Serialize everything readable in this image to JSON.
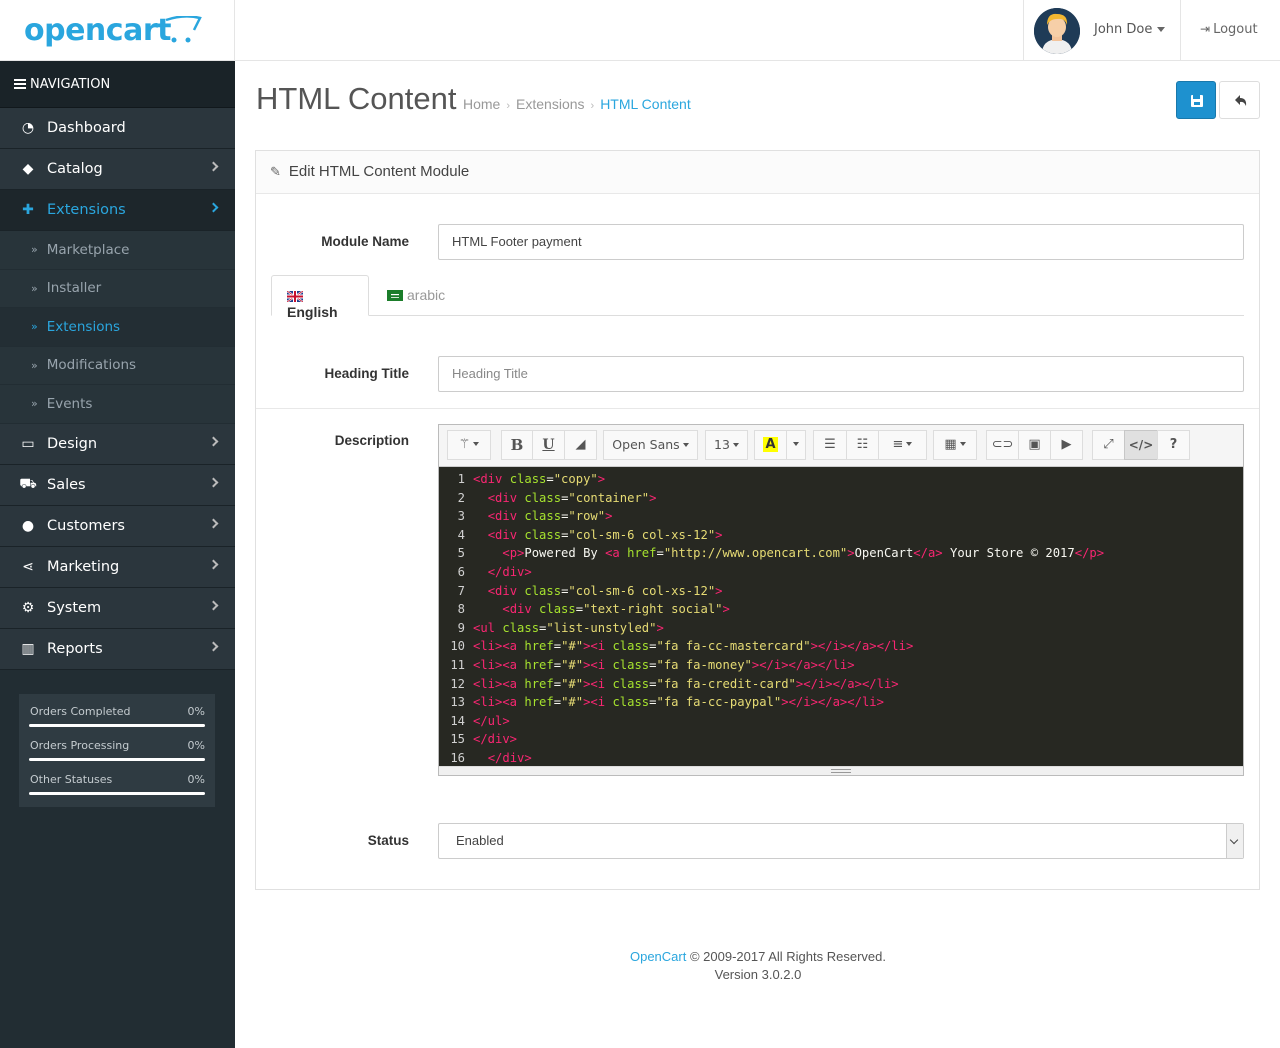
{
  "brand": {
    "name": "opencart"
  },
  "header": {
    "username": "John Doe",
    "logout_label": "Logout"
  },
  "nav": {
    "heading": "NAVIGATION",
    "items": [
      {
        "label": "Dashboard",
        "icon": "dashboard-icon"
      },
      {
        "label": "Catalog",
        "icon": "tag-icon"
      },
      {
        "label": "Extensions",
        "icon": "puzzle-icon"
      },
      {
        "label": "Design",
        "icon": "monitor-icon"
      },
      {
        "label": "Sales",
        "icon": "cart-icon"
      },
      {
        "label": "Customers",
        "icon": "user-icon"
      },
      {
        "label": "Marketing",
        "icon": "share-icon"
      },
      {
        "label": "System",
        "icon": "gear-icon"
      },
      {
        "label": "Reports",
        "icon": "bar-chart-icon"
      }
    ],
    "extensions_sub": [
      "Marketplace",
      "Installer",
      "Extensions",
      "Modifications",
      "Events"
    ]
  },
  "stats": [
    {
      "label": "Orders Completed",
      "value": "0%"
    },
    {
      "label": "Orders Processing",
      "value": "0%"
    },
    {
      "label": "Other Statuses",
      "value": "0%"
    }
  ],
  "page": {
    "title": "HTML Content",
    "breadcrumb": [
      "Home",
      "Extensions",
      "HTML Content"
    ]
  },
  "panel": {
    "heading": "Edit HTML Content Module",
    "module_name_label": "Module Name",
    "module_name_value": "HTML Footer payment",
    "tabs": [
      "English",
      "arabic"
    ],
    "heading_title_label": "Heading Title",
    "heading_title_placeholder": "Heading Title",
    "description_label": "Description",
    "status_label": "Status",
    "status_value": "Enabled"
  },
  "editor": {
    "font_name": "Open Sans",
    "font_size": "13",
    "lines": [
      {
        "n": "1",
        "indent": "",
        "parts": [
          [
            "tg",
            "<div "
          ],
          [
            "at",
            "class"
          ],
          [
            "tx",
            "="
          ],
          [
            "st",
            "\"copy\""
          ],
          [
            "tg",
            ">"
          ]
        ]
      },
      {
        "n": "2",
        "indent": "  ",
        "parts": [
          [
            "tg",
            "<div "
          ],
          [
            "at",
            "class"
          ],
          [
            "tx",
            "="
          ],
          [
            "st",
            "\"container\""
          ],
          [
            "tg",
            ">"
          ]
        ]
      },
      {
        "n": "3",
        "indent": "  ",
        "parts": [
          [
            "tg",
            "<div "
          ],
          [
            "at",
            "class"
          ],
          [
            "tx",
            "="
          ],
          [
            "st",
            "\"row\""
          ],
          [
            "tg",
            ">"
          ]
        ]
      },
      {
        "n": "4",
        "indent": "  ",
        "parts": [
          [
            "tg",
            "<div "
          ],
          [
            "at",
            "class"
          ],
          [
            "tx",
            "="
          ],
          [
            "st",
            "\"col-sm-6 col-xs-12\""
          ],
          [
            "tg",
            ">"
          ]
        ]
      },
      {
        "n": "5",
        "indent": "    ",
        "parts": [
          [
            "tg",
            "<p>"
          ],
          [
            "tx",
            "Powered By "
          ],
          [
            "tg",
            "<a "
          ],
          [
            "at",
            "href"
          ],
          [
            "tx",
            "="
          ],
          [
            "st",
            "\"http://www.opencart.com\""
          ],
          [
            "tg",
            ">"
          ],
          [
            "tx",
            "OpenCart"
          ],
          [
            "tg",
            "</a>"
          ],
          [
            "tx",
            " Your Store © 2017"
          ],
          [
            "tg",
            "</p>"
          ]
        ]
      },
      {
        "n": "6",
        "indent": "  ",
        "parts": [
          [
            "tg",
            "</div>"
          ]
        ]
      },
      {
        "n": "7",
        "indent": "  ",
        "parts": [
          [
            "tg",
            "<div "
          ],
          [
            "at",
            "class"
          ],
          [
            "tx",
            "="
          ],
          [
            "st",
            "\"col-sm-6 col-xs-12\""
          ],
          [
            "tg",
            ">"
          ]
        ]
      },
      {
        "n": "8",
        "indent": "    ",
        "parts": [
          [
            "tg",
            "<div "
          ],
          [
            "at",
            "class"
          ],
          [
            "tx",
            "="
          ],
          [
            "st",
            "\"text-right social\""
          ],
          [
            "tg",
            ">"
          ]
        ]
      },
      {
        "n": "9",
        "indent": "",
        "parts": [
          [
            "tg",
            "<ul "
          ],
          [
            "at",
            "class"
          ],
          [
            "tx",
            "="
          ],
          [
            "st",
            "\"list-unstyled\""
          ],
          [
            "tg",
            ">"
          ]
        ]
      },
      {
        "n": "10",
        "indent": "",
        "parts": [
          [
            "tg",
            "<li><a "
          ],
          [
            "at",
            "href"
          ],
          [
            "tx",
            "="
          ],
          [
            "st",
            "\"#\""
          ],
          [
            "tg",
            "><i "
          ],
          [
            "at",
            "class"
          ],
          [
            "tx",
            "="
          ],
          [
            "st",
            "\"fa fa-cc-mastercard\""
          ],
          [
            "tg",
            "></i></a></li>"
          ]
        ]
      },
      {
        "n": "11",
        "indent": "",
        "parts": [
          [
            "tg",
            "<li><a "
          ],
          [
            "at",
            "href"
          ],
          [
            "tx",
            "="
          ],
          [
            "st",
            "\"#\""
          ],
          [
            "tg",
            "><i "
          ],
          [
            "at",
            "class"
          ],
          [
            "tx",
            "="
          ],
          [
            "st",
            "\"fa fa-money\""
          ],
          [
            "tg",
            "></i></a></li>"
          ]
        ]
      },
      {
        "n": "12",
        "indent": "",
        "parts": [
          [
            "tg",
            "<li><a "
          ],
          [
            "at",
            "href"
          ],
          [
            "tx",
            "="
          ],
          [
            "st",
            "\"#\""
          ],
          [
            "tg",
            "><i "
          ],
          [
            "at",
            "class"
          ],
          [
            "tx",
            "="
          ],
          [
            "st",
            "\"fa fa-credit-card\""
          ],
          [
            "tg",
            "></i></a></li>"
          ]
        ]
      },
      {
        "n": "13",
        "indent": "",
        "parts": [
          [
            "tg",
            "<li><a "
          ],
          [
            "at",
            "href"
          ],
          [
            "tx",
            "="
          ],
          [
            "st",
            "\"#\""
          ],
          [
            "tg",
            "><i "
          ],
          [
            "at",
            "class"
          ],
          [
            "tx",
            "="
          ],
          [
            "st",
            "\"fa fa-cc-paypal\""
          ],
          [
            "tg",
            "></i></a></li>"
          ]
        ]
      },
      {
        "n": "14",
        "indent": "",
        "parts": [
          [
            "tg",
            "</ul>"
          ]
        ]
      },
      {
        "n": "15",
        "indent": "",
        "parts": [
          [
            "tg",
            "</div>"
          ]
        ]
      },
      {
        "n": "16",
        "indent": "  ",
        "parts": [
          [
            "tg",
            "</div>"
          ]
        ]
      }
    ]
  },
  "footer": {
    "link": "OpenCart",
    "copyright": " © 2009-2017 All Rights Reserved.",
    "version": "Version 3.0.2.0"
  },
  "colors": {
    "accent": "#2aa6de",
    "sidebar": "#222d33",
    "save_button": "#1e91cf"
  }
}
